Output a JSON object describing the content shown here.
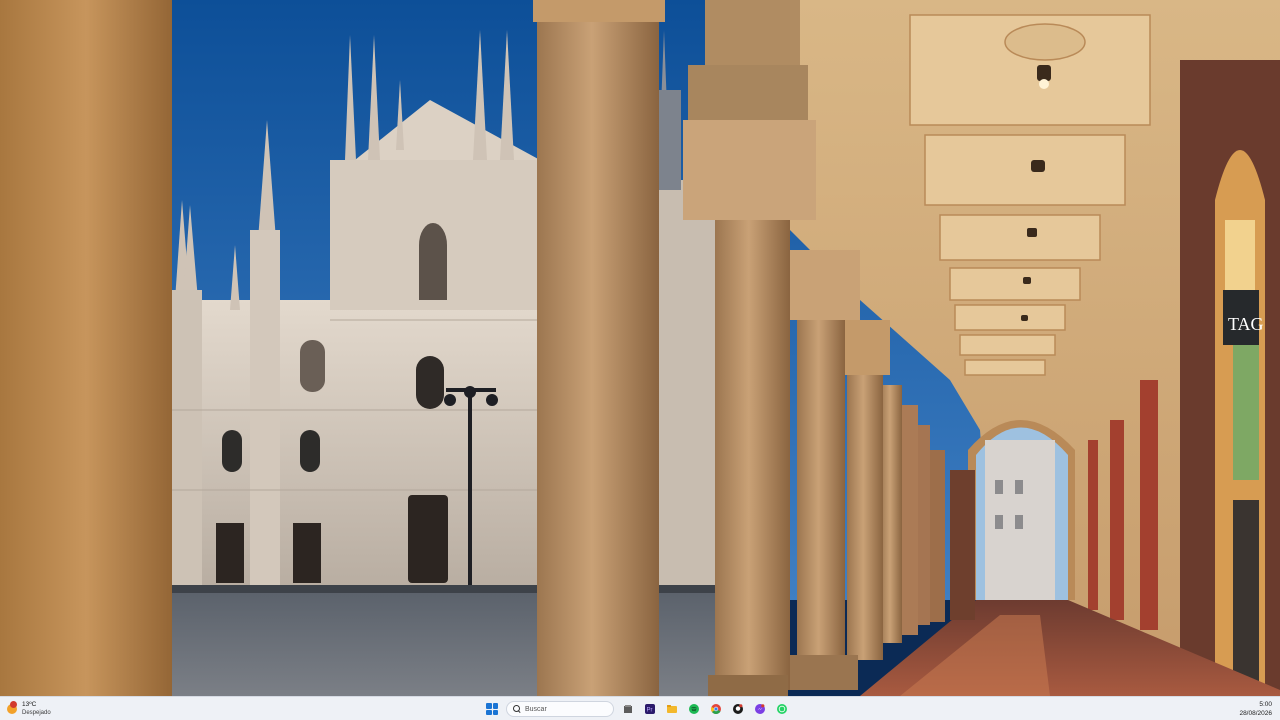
{
  "wallpaper": {
    "palette": {
      "sky_top": "#0d4f98",
      "sky_bottom": "#3f7fc3",
      "cathedral": "#d9cfc3",
      "column_warm": "#b88a56",
      "column_dark": "#8f6638",
      "arcade_light": "#e9c896",
      "floor": "#7a4032"
    }
  },
  "taskbar": {
    "weather": {
      "temp": "13ºC",
      "desc": "Despejado",
      "icon": "sun-icon"
    },
    "search": {
      "placeholder": "Buscar"
    },
    "apps": [
      {
        "name": "file-manager-icon",
        "color": "#5c5c5c"
      },
      {
        "name": "premiere-icon",
        "color": "#2b1a6b"
      },
      {
        "name": "folder-icon",
        "color": "#f3b82c"
      },
      {
        "name": "spotify-icon",
        "color": "#1db954"
      },
      {
        "name": "chrome-icon",
        "color": "#e3443a"
      },
      {
        "name": "github-icon",
        "color": "#1b1b1b"
      },
      {
        "name": "messenger-icon",
        "color": "#7b3fe4"
      },
      {
        "name": "whatsapp-icon",
        "color": "#25d366"
      }
    ],
    "clock": {
      "time": "5:00",
      "date": "28/08/2026"
    }
  }
}
